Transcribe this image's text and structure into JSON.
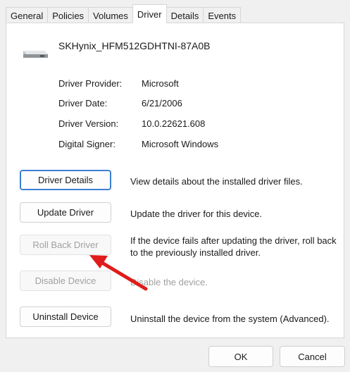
{
  "tabs": [
    {
      "label": "General"
    },
    {
      "label": "Policies"
    },
    {
      "label": "Volumes"
    },
    {
      "label": "Driver",
      "active": true
    },
    {
      "label": "Details"
    },
    {
      "label": "Events"
    }
  ],
  "device": {
    "name": "SKHynix_HFM512GDHTNI-87A0B",
    "icon": "drive-icon"
  },
  "info": {
    "provider_label": "Driver Provider:",
    "provider_value": "Microsoft",
    "date_label": "Driver Date:",
    "date_value": "6/21/2006",
    "version_label": "Driver Version:",
    "version_value": "10.0.22621.608",
    "signer_label": "Digital Signer:",
    "signer_value": "Microsoft Windows"
  },
  "actions": {
    "details_label": "Driver Details",
    "details_desc": "View details about the installed driver files.",
    "update_label": "Update Driver",
    "update_desc": "Update the driver for this device.",
    "rollback_label": "Roll Back Driver",
    "rollback_desc": "If the device fails after updating the driver, roll back to the previously installed driver.",
    "disable_label": "Disable Device",
    "disable_desc": "Disable the device.",
    "uninstall_label": "Uninstall Device",
    "uninstall_desc": "Uninstall the device from the system (Advanced)."
  },
  "footer": {
    "ok_label": "OK",
    "cancel_label": "Cancel"
  },
  "colors": {
    "annotation_arrow": "#e01b1b",
    "focus_border": "#3c7fd4",
    "disabled_text": "#a0a0a0"
  }
}
